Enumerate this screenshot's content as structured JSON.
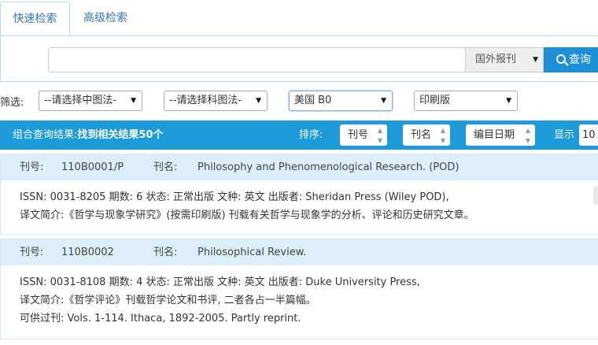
{
  "tabs": {
    "quick": "快速检索",
    "advanced": "高级检索"
  },
  "search": {
    "query": "",
    "scope": "国外报刊",
    "button": "查询"
  },
  "filter": {
    "label": "筛选:",
    "clc": "--请选择中图法-",
    "sci": "--请选择科图法-",
    "country": "美国 B0",
    "format": "印刷版"
  },
  "results_bar": {
    "prefix": "组合查询结果:",
    "found": "找到相关结果50个",
    "sort_label": "排序:",
    "sort_options": [
      "刊号",
      "刊名",
      "编目日期"
    ],
    "show_label": "显示",
    "page_size": "10"
  },
  "records": [
    {
      "id_label": "刊号:",
      "id": "110B0001/P",
      "title_label": "刊名:",
      "title": "Philosophy and Phenomenological Research. (POD)",
      "detail": "ISSN: 0031-8205  期数: 6  状态: 正常出版  文种: 英文  出版者: Sheridan Press (Wiley POD),",
      "summary": "译文简介:《哲学与现象学研究》(按需印刷版) 刊载有关哲学与现象学的分析、评论和历史研究文章。",
      "holdings": ""
    },
    {
      "id_label": "刊号:",
      "id": "110B0002",
      "title_label": "刊名:",
      "title": "Philosophical Review.",
      "detail": "ISSN: 0031-8108  期数: 4  状态: 正常出版  文种: 英文  出版者: Duke University Press,",
      "summary": "译文简介:《哲学评论》刊载哲学论文和书评, 二者各占一半篇幅。",
      "holdings": "可供过刊: Vols. 1-114. Ithaca, 1892-2005. Partly reprint."
    }
  ]
}
